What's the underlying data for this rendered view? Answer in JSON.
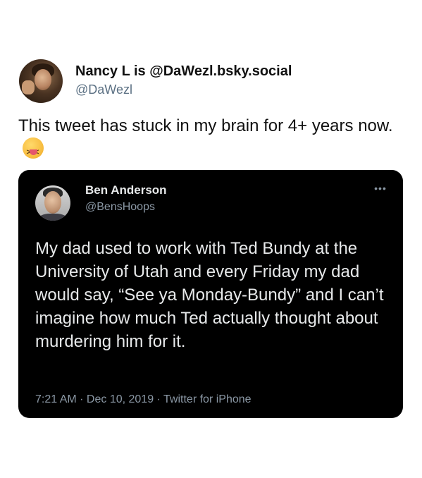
{
  "outer_tweet": {
    "display_name": "Nancy L is @DaWezl.bsky.social",
    "handle": "@DaWezl",
    "text": "This tweet has stuck in my brain for 4+ years now.",
    "emoji": "squinting-face-with-tongue"
  },
  "quoted_tweet": {
    "display_name": "Ben Anderson",
    "handle": "@BensHoops",
    "more_label": "•••",
    "text": "My dad used to work with Ted Bundy at the University of Utah and every Friday my dad would say, “See ya Monday-Bundy” and I can’t imagine how much Ted actually thought about murdering him for it.",
    "timestamp": "7:21 AM · Dec 10, 2019 · Twitter for iPhone"
  },
  "colors": {
    "card_background": "#000000",
    "card_text": "#e7e9ea",
    "muted": "#8b98a5"
  }
}
